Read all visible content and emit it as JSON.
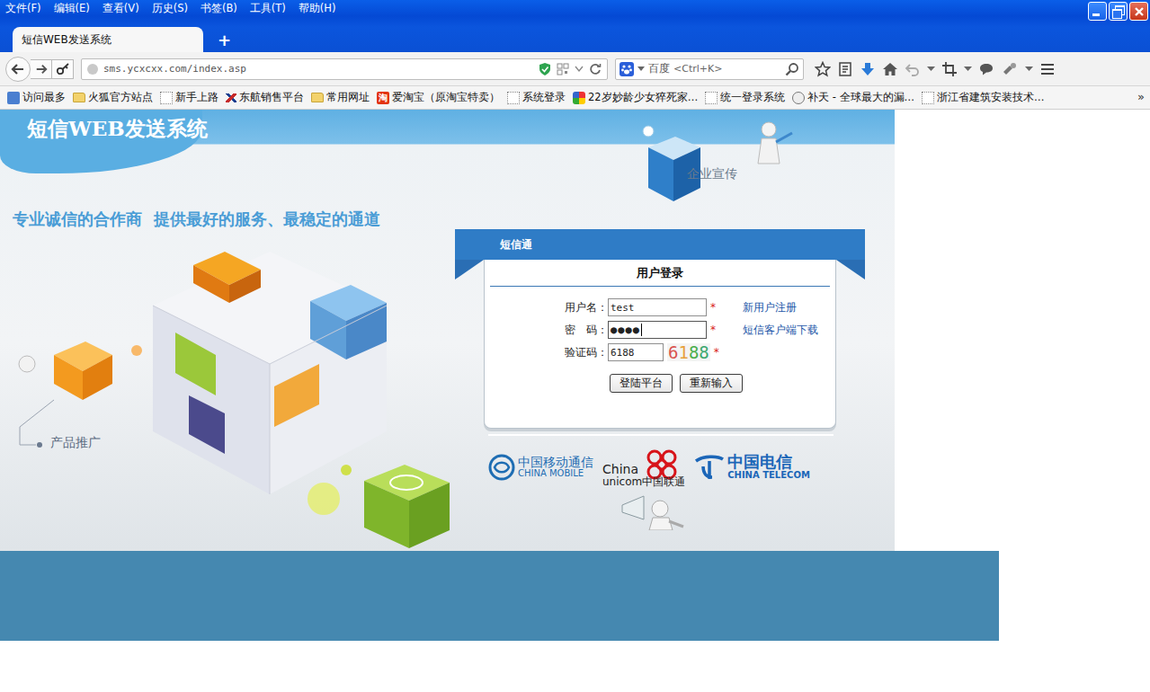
{
  "menu": [
    "文件(F)",
    "编辑(E)",
    "查看(V)",
    "历史(S)",
    "书签(B)",
    "工具(T)",
    "帮助(H)"
  ],
  "tabs": [
    {
      "label": "短信WEB发送系统",
      "selected": true
    }
  ],
  "new_tab": "+",
  "address": {
    "url": "sms.ycxcxx.com/index.asp"
  },
  "search": {
    "engine": "百度",
    "placeholder": "<Ctrl+K>"
  },
  "bookmarks": {
    "items": [
      {
        "label": "访问最多",
        "kind": "smart"
      },
      {
        "label": "火狐官方站点",
        "kind": "folder"
      },
      {
        "label": "新手上路",
        "kind": "page"
      },
      {
        "label": "东航销售平台",
        "kind": "airline"
      },
      {
        "label": "常用网址",
        "kind": "folder"
      },
      {
        "label": "爱淘宝（原淘宝特卖）",
        "kind": "taobao",
        "badge": "淘"
      },
      {
        "label": "系统登录",
        "kind": "page"
      },
      {
        "label": "22岁妙龄少女猝死家…",
        "kind": "news"
      },
      {
        "label": "统一登录系统",
        "kind": "page"
      },
      {
        "label": "补天 - 全球最大的漏…",
        "kind": "star"
      },
      {
        "label": "浙江省建筑安装技术…",
        "kind": "page"
      }
    ],
    "overflow": "»"
  },
  "page": {
    "brand": "短信WEB发送系统",
    "promo": "企业宣传",
    "slogan": "专业诚信的合作商  提供最好的服务、最稳定的通道",
    "product": "产品推广",
    "login": {
      "header": "短信通",
      "title": "用户登录",
      "required": "*",
      "fields": [
        {
          "label": "用户名：",
          "value": "test",
          "kind": "text",
          "focused": false,
          "link": "新用户注册"
        },
        {
          "label": "密　码：",
          "value": "●●●●",
          "kind": "password",
          "focused": true,
          "link": "短信客户端下载"
        },
        {
          "label": "验证码：",
          "value": "6188",
          "kind": "captcha",
          "focused": false,
          "captcha": [
            {
              "char": "6",
              "color": "#d9534f"
            },
            {
              "char": "1",
              "color": "#e8a13a"
            },
            {
              "char": "8",
              "color": "#4cae4c"
            },
            {
              "char": "8",
              "color": "#3fa86f"
            }
          ]
        }
      ],
      "buttons": [
        "登陆平台",
        "重新输入"
      ]
    },
    "carriers": [
      {
        "kind": "mobile",
        "lines": [
          "中国移动通信",
          "CHINA MOBILE"
        ],
        "color": "#1e6db3"
      },
      {
        "kind": "unicom",
        "lines": [
          "China",
          "unicom中国联通"
        ],
        "color": "#d7141a"
      },
      {
        "kind": "telecom",
        "lines": [
          "中国电信",
          "CHINA TELECOM"
        ],
        "color": "#1b66b8"
      }
    ]
  }
}
